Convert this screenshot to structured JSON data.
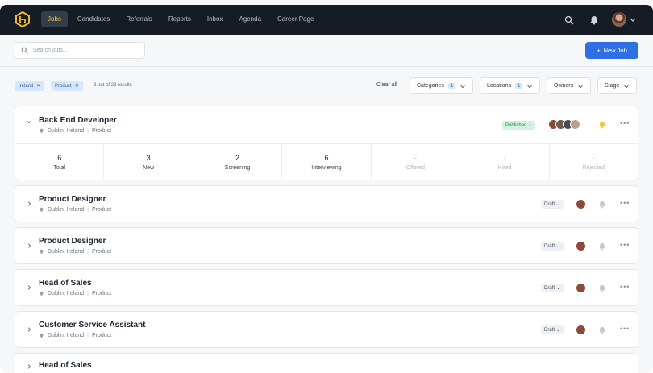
{
  "topbar": {
    "nav": [
      {
        "label": "Jobs",
        "active": true
      },
      {
        "label": "Candidates"
      },
      {
        "label": "Referrals"
      },
      {
        "label": "Reports"
      },
      {
        "label": "Inbox"
      },
      {
        "label": "Agenda"
      },
      {
        "label": "Career Page"
      }
    ],
    "icons": [
      "search-icon",
      "bell-icon",
      "avatar",
      "chevron-down-icon"
    ]
  },
  "search": {
    "placeholder": "Search jobs..."
  },
  "new_job_label": "New Job",
  "filters": {
    "chips": [
      "Ireland",
      "Product"
    ],
    "results_text": "3 out of 23 results",
    "clear_all": "Clear all",
    "categories": {
      "label": "Categories",
      "count": "1"
    },
    "locations": {
      "label": "Locations",
      "count": "1"
    },
    "owners": {
      "label": "Owners"
    },
    "stage": {
      "label": "Stage"
    }
  },
  "jobs": [
    {
      "title": "Back End Developer",
      "location": "Dublin, Ireland",
      "department": "Product",
      "status": "Published",
      "expanded": true,
      "stats": [
        {
          "value": "6",
          "label": "Total"
        },
        {
          "value": "3",
          "label": "New"
        },
        {
          "value": "2",
          "label": "Screening"
        },
        {
          "value": "6",
          "label": "Interviewing"
        },
        {
          "value": "-",
          "label": "Offered"
        },
        {
          "value": "-",
          "label": "Hired"
        },
        {
          "value": "-",
          "label": "Rejected"
        }
      ]
    },
    {
      "title": "Product Designer",
      "location": "Dublin, Ireland",
      "department": "Product",
      "status": "Draft"
    },
    {
      "title": "Product Designer",
      "location": "Dublin, Ireland",
      "department": "Product",
      "status": "Draft"
    },
    {
      "title": "Head of Sales",
      "location": "Dublin, Ireland",
      "department": "Product",
      "status": "Draft"
    },
    {
      "title": "Customer Service Assistant",
      "location": "Dublin, Ireland",
      "department": "Product",
      "status": "Draft"
    },
    {
      "title": "Head of Sales"
    }
  ],
  "colors": {
    "accent": "#2f6fe4",
    "nav_bg": "#151c24",
    "active_nav": "#f2c53d",
    "published": "#1f8a4c"
  }
}
